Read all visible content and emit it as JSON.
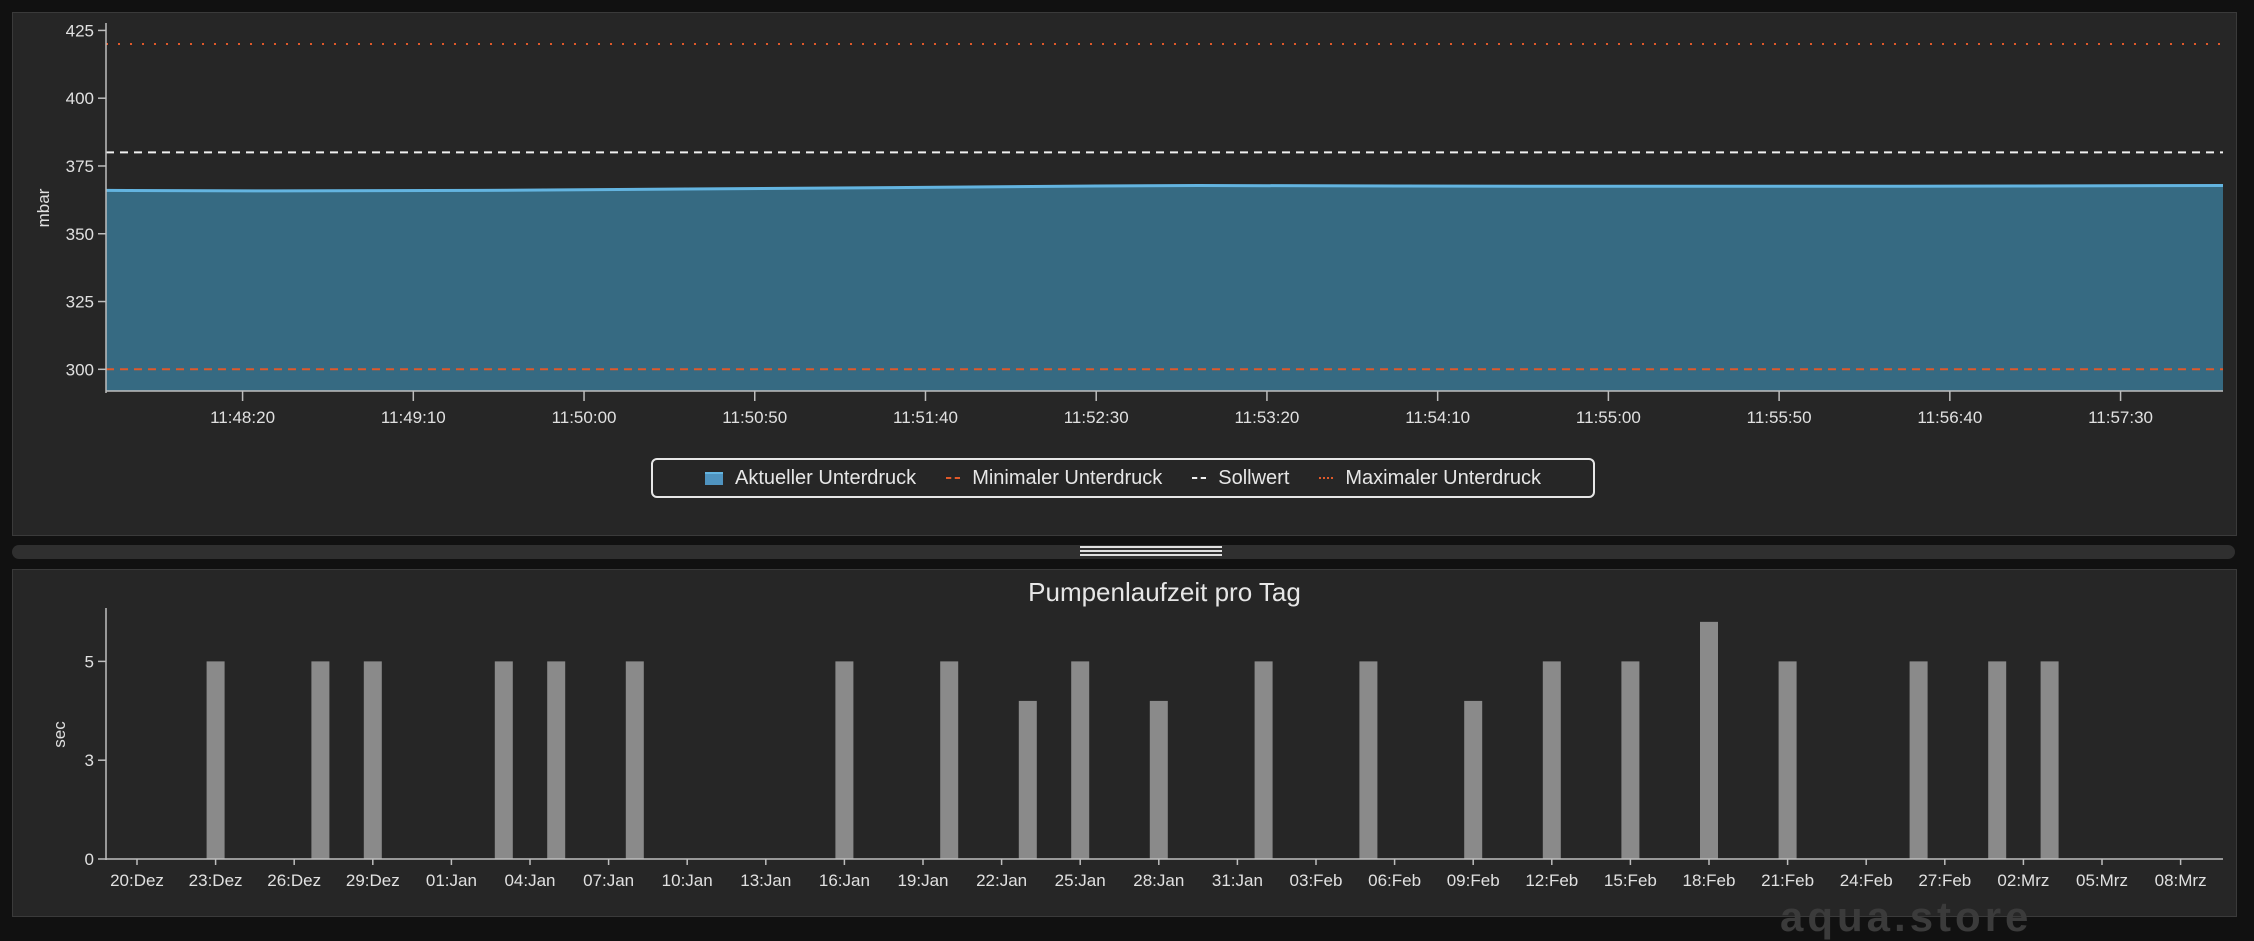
{
  "chart_data": [
    {
      "type": "area",
      "ylabel": "mbar",
      "ylim": [
        292,
        427
      ],
      "yticks": [
        300,
        325,
        350,
        375,
        400,
        425
      ],
      "xlim": [
        "11:47:40",
        "11:58:00"
      ],
      "xticks": [
        "11:48:20",
        "11:49:10",
        "11:50:00",
        "11:50:50",
        "11:51:40",
        "11:52:30",
        "11:53:20",
        "11:54:10",
        "11:55:00",
        "11:55:50",
        "11:56:40",
        "11:57:30"
      ],
      "grid": false,
      "legend_position": "bottom-center",
      "series": [
        {
          "name": "Aktueller Unterdruck",
          "style": "area",
          "color": "#4f93bf",
          "x": [
            "11:47:40",
            "11:48:30",
            "11:49:30",
            "11:50:30",
            "11:51:30",
            "11:52:30",
            "11:53:00",
            "11:54:00",
            "11:55:00",
            "11:56:00",
            "11:57:00",
            "11:58:00"
          ],
          "values": [
            366,
            365.8,
            366,
            366.5,
            367,
            367.6,
            367.8,
            367.6,
            367.5,
            367.5,
            367.6,
            367.8
          ]
        },
        {
          "name": "Minimaler Unterdruck",
          "style": "dashed",
          "color": "#e0592a",
          "value": 300
        },
        {
          "name": "Sollwert",
          "style": "dashed",
          "color": "#f0f0f0",
          "value": 380
        },
        {
          "name": "Maximaler Unterdruck",
          "style": "dotted",
          "color": "#e0592a",
          "value": 420
        }
      ]
    },
    {
      "type": "bar",
      "title": "Pumpenlaufzeit pro Tag",
      "ylabel": "sec",
      "ylim": [
        0,
        6.3
      ],
      "yticks": [
        0,
        3,
        5
      ],
      "ytick_positions": [
        0,
        2.5,
        5
      ],
      "color": "#8a8a8a",
      "grid": false,
      "start_date": "20:Dez",
      "xticks": [
        "20:Dez",
        "23:Dez",
        "26:Dez",
        "29:Dez",
        "01:Jan",
        "04:Jan",
        "07:Jan",
        "10:Jan",
        "13:Jan",
        "16:Jan",
        "19:Jan",
        "22:Jan",
        "25:Jan",
        "28:Jan",
        "31:Jan",
        "03:Feb",
        "06:Feb",
        "09:Feb",
        "12:Feb",
        "15:Feb",
        "18:Feb",
        "21:Feb",
        "24:Feb",
        "27:Feb",
        "02:Mrz",
        "05:Mrz",
        "08:Mrz"
      ],
      "bars": [
        {
          "date": "23:Dez",
          "value": 5
        },
        {
          "date": "27:Dez",
          "value": 5
        },
        {
          "date": "29:Dez",
          "value": 5
        },
        {
          "date": "03:Jan",
          "value": 5
        },
        {
          "date": "05:Jan",
          "value": 5
        },
        {
          "date": "08:Jan",
          "value": 5
        },
        {
          "date": "16:Jan",
          "value": 5
        },
        {
          "date": "20:Jan",
          "value": 5
        },
        {
          "date": "23:Jan",
          "value": 4
        },
        {
          "date": "25:Jan",
          "value": 5
        },
        {
          "date": "28:Jan",
          "value": 4
        },
        {
          "date": "01:Feb",
          "value": 5
        },
        {
          "date": "05:Feb",
          "value": 5
        },
        {
          "date": "09:Feb",
          "value": 4
        },
        {
          "date": "12:Feb",
          "value": 5
        },
        {
          "date": "15:Feb",
          "value": 5
        },
        {
          "date": "18:Feb",
          "value": 6
        },
        {
          "date": "21:Feb",
          "value": 5
        },
        {
          "date": "26:Feb",
          "value": 5
        },
        {
          "date": "01:Mrz",
          "value": 5
        },
        {
          "date": "03:Mrz",
          "value": 5
        }
      ]
    }
  ],
  "legend": {
    "items": [
      {
        "label": "Aktueller Unterdruck",
        "color": "#4f93bf"
      },
      {
        "label": "Minimaler Unterdruck",
        "color": "#e0592a"
      },
      {
        "label": "Sollwert",
        "color": "#f0f0f0"
      },
      {
        "label": "Maximaler Unterdruck",
        "color": "#e0592a"
      }
    ]
  },
  "watermark": "aqua.store"
}
